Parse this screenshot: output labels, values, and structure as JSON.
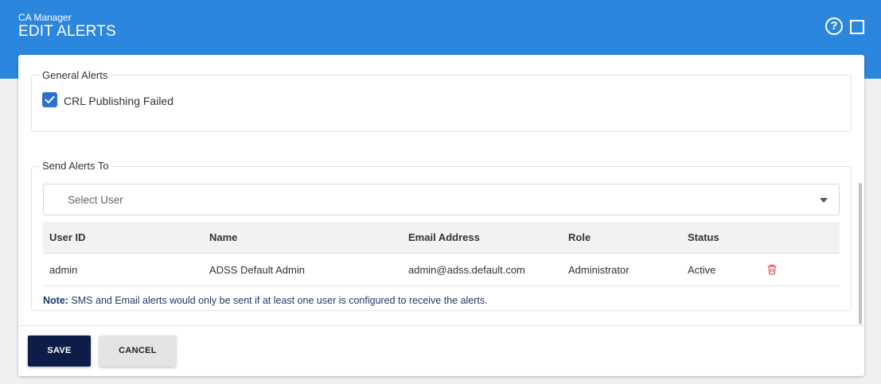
{
  "header": {
    "app_name": "CA Manager",
    "title": "EDIT ALERTS",
    "help_icon": "help-circle-icon",
    "maximize_icon": "maximize-icon"
  },
  "general_alerts": {
    "legend": "General Alerts",
    "checkbox_label": "CRL Publishing Failed",
    "checked": true
  },
  "send_alerts": {
    "legend": "Send Alerts To",
    "select_placeholder": "Select User",
    "table": {
      "headers": [
        "User ID",
        "Name",
        "Email Address",
        "Role",
        "Status"
      ],
      "rows": [
        {
          "user_id": "admin",
          "name": "ADSS Default Admin",
          "email": "admin@adss.default.com",
          "role": "Administrator",
          "status": "Active"
        }
      ]
    },
    "note_prefix": "Note:",
    "note_text": " SMS and Email alerts would only be sent if at least one user is configured to receive the alerts."
  },
  "footer": {
    "save_label": "SAVE",
    "cancel_label": "CANCEL"
  },
  "colors": {
    "header_bg": "#2b87dd",
    "save_bg": "#0d1d47",
    "checkbox": "#2f6fcf",
    "delete_icon": "#d9534f"
  }
}
